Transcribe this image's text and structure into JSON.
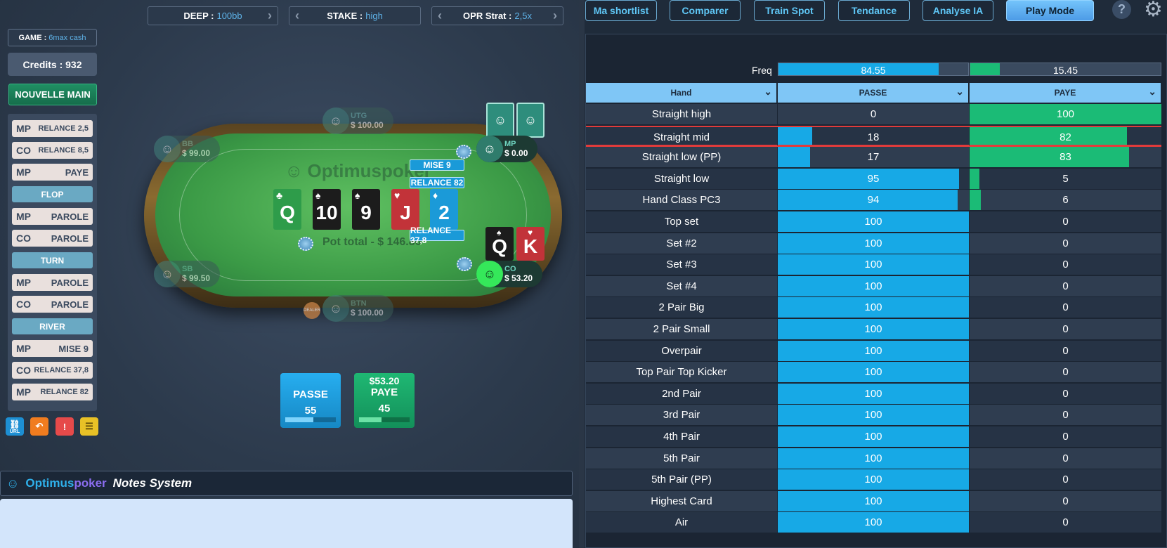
{
  "top_controls": {
    "deep": {
      "key": "DEEP :",
      "value": "100bb"
    },
    "stake": {
      "key": "STAKE :",
      "value": "high"
    },
    "opr": {
      "key": "OPR Strat :",
      "value": "2,5x"
    }
  },
  "game": {
    "key": "GAME :",
    "value": "6max cash"
  },
  "credits": "Credits : 932",
  "new_hand_label": "NOUVELLE MAIN",
  "history": {
    "preflop": [
      {
        "pos": "MP",
        "action": "RELANCE 2,5"
      },
      {
        "pos": "CO",
        "action": "RELANCE 8,5"
      },
      {
        "pos": "MP",
        "action": "PAYE"
      }
    ],
    "flop_label": "FLOP",
    "flop": [
      {
        "pos": "MP",
        "action": "PAROLE"
      },
      {
        "pos": "CO",
        "action": "PAROLE"
      }
    ],
    "turn_label": "TURN",
    "turn": [
      {
        "pos": "MP",
        "action": "PAROLE"
      },
      {
        "pos": "CO",
        "action": "PAROLE"
      }
    ],
    "river_label": "RIVER",
    "river": [
      {
        "pos": "MP",
        "action": "MISE 9"
      },
      {
        "pos": "CO",
        "action": "RELANCE 37,8"
      },
      {
        "pos": "MP",
        "action": "RELANCE 82"
      }
    ]
  },
  "tools": {
    "url_label": "URL"
  },
  "table": {
    "brand": "Optimuspoker",
    "pot": "Pot total - $ 146.80",
    "board": [
      {
        "rank": "Q",
        "suit": "♣",
        "color": "#2e9c4a"
      },
      {
        "rank": "10",
        "suit": "♠",
        "color": "#1c1c1c"
      },
      {
        "rank": "9",
        "suit": "♠",
        "color": "#1c1c1c"
      },
      {
        "rank": "J",
        "suit": "♥",
        "color": "#c23339"
      },
      {
        "rank": "2",
        "suit": "♦",
        "color": "#1b9ad8"
      }
    ],
    "bets": {
      "mise": "MISE 9",
      "relance82": "RELANCE 82",
      "relance378": "RELANCE 37,8"
    },
    "dealer_label": "DEALER",
    "seats": {
      "utg": {
        "name": "UTG",
        "stack": "$ 100.00"
      },
      "bb": {
        "name": "BB",
        "stack": "$ 99.00"
      },
      "mp": {
        "name": "MP",
        "stack": "$ 0.00"
      },
      "sb": {
        "name": "SB",
        "stack": "$ 99.50"
      },
      "btn": {
        "name": "BTN",
        "stack": "$ 100.00"
      },
      "co": {
        "name": "CO",
        "stack": "$ 53.20"
      }
    },
    "hero_cards": [
      {
        "rank": "Q",
        "suit": "♠",
        "color": "#1c1c1c"
      },
      {
        "rank": "K",
        "suit": "♥",
        "color": "#c23339"
      }
    ]
  },
  "actions": {
    "passe": {
      "label": "PASSE",
      "pct": "55",
      "fill": 0.55
    },
    "paye": {
      "amount": "$53.20",
      "label": "PAYE",
      "pct": "45",
      "fill": 0.45
    }
  },
  "notes": {
    "brand_a": "Optimus",
    "brand_b": "poker",
    "title": "Notes System"
  },
  "nav": {
    "shortlist": "Ma shortlist",
    "comparer": "Comparer",
    "train": "Train Spot",
    "tendance": "Tendance",
    "analyse": "Analyse IA",
    "play": "Play Mode",
    "help": "?"
  },
  "freq": {
    "label": "Freq",
    "passe": "84.55",
    "paye": "15.45",
    "passe_fill": 0.8455,
    "paye_fill": 0.1545
  },
  "strategy_table": {
    "headers": [
      "Hand",
      "PASSE",
      "PAYE"
    ],
    "rows": [
      {
        "hand": "Straight high",
        "passe": "0",
        "paye": "100"
      },
      {
        "hand": "Straight mid",
        "passe": "18",
        "paye": "82"
      },
      {
        "hand": "Straight low (PP)",
        "passe": "17",
        "paye": "83"
      },
      {
        "hand": "Straight low",
        "passe": "95",
        "paye": "5"
      },
      {
        "hand": "Hand Class PC3",
        "passe": "94",
        "paye": "6"
      },
      {
        "hand": "Top set",
        "passe": "100",
        "paye": "0"
      },
      {
        "hand": "Set #2",
        "passe": "100",
        "paye": "0"
      },
      {
        "hand": "Set #3",
        "passe": "100",
        "paye": "0"
      },
      {
        "hand": "Set #4",
        "passe": "100",
        "paye": "0"
      },
      {
        "hand": "2 Pair Big",
        "passe": "100",
        "paye": "0"
      },
      {
        "hand": "2 Pair Small",
        "passe": "100",
        "paye": "0"
      },
      {
        "hand": "Overpair",
        "passe": "100",
        "paye": "0"
      },
      {
        "hand": "Top Pair Top Kicker",
        "passe": "100",
        "paye": "0"
      },
      {
        "hand": "2nd Pair",
        "passe": "100",
        "paye": "0"
      },
      {
        "hand": "3rd Pair",
        "passe": "100",
        "paye": "0"
      },
      {
        "hand": "4th Pair",
        "passe": "100",
        "paye": "0"
      },
      {
        "hand": "5th Pair",
        "passe": "100",
        "paye": "0"
      },
      {
        "hand": "5th Pair (PP)",
        "passe": "100",
        "paye": "0"
      },
      {
        "hand": "Highest Card",
        "passe": "100",
        "paye": "0"
      },
      {
        "hand": "Air",
        "passe": "100",
        "paye": "0"
      }
    ],
    "selected_row": "Straight mid"
  },
  "colors": {
    "passe": "#17a9e6",
    "paye": "#1bbb76",
    "selection": "#e23b3b"
  }
}
